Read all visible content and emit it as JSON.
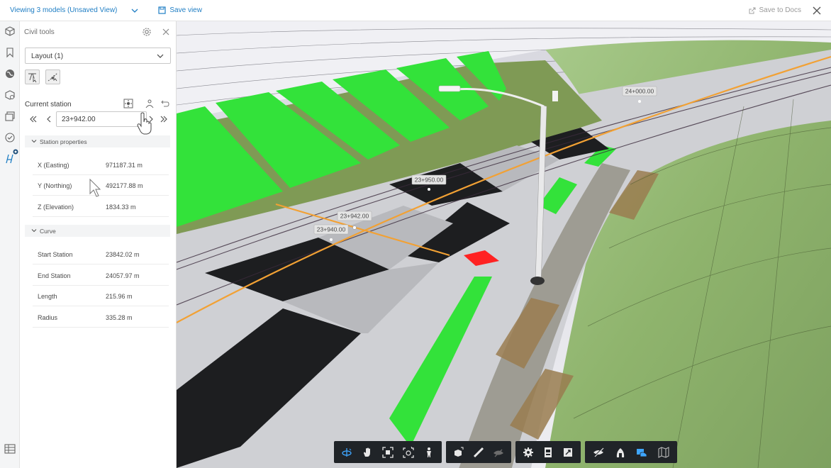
{
  "topbar": {
    "views_label": "Viewing 3 models (Unsaved View)",
    "save_view_label": "Save view",
    "save_docs_label": "Save to Docs"
  },
  "panel": {
    "title": "Civil tools",
    "layout_select": "Layout (1)",
    "current_station_label": "Current station",
    "station_value": "23+942.00"
  },
  "station_properties": {
    "title": "Station properties",
    "rows": [
      {
        "key": "X (Easting)",
        "value": "971187.31 m"
      },
      {
        "key": "Y (Northing)",
        "value": "492177.88 m"
      },
      {
        "key": "Z (Elevation)",
        "value": "1834.33 m"
      }
    ]
  },
  "curve": {
    "title": "Curve",
    "rows": [
      {
        "key": "Start Station",
        "value": "23842.02 m"
      },
      {
        "key": "End Station",
        "value": "24057.97 m"
      },
      {
        "key": "Length",
        "value": "215.96 m"
      },
      {
        "key": "Radius",
        "value": "335.28 m"
      }
    ]
  },
  "viewport": {
    "station_tags": [
      "24+000.00",
      "23+950.00",
      "23+942.00",
      "23+940.00"
    ]
  },
  "toolbar": {
    "groups": [
      [
        "orbit-icon",
        "pan-icon",
        "fit-to-view-icon",
        "focus-icon",
        "first-person-icon"
      ],
      [
        "explode-model-icon",
        "measure-icon",
        "section-icon"
      ],
      [
        "settings-icon",
        "properties-icon",
        "fullscreen-icon"
      ],
      [
        "hide-icon",
        "isolate-icon",
        "civil-tools-icon",
        "map-icon"
      ]
    ]
  },
  "colors": {
    "accent": "#1f7ec4",
    "alignment": "#f2a134",
    "green_zone": "#33e23a",
    "toolbar_bg": "#202428"
  }
}
